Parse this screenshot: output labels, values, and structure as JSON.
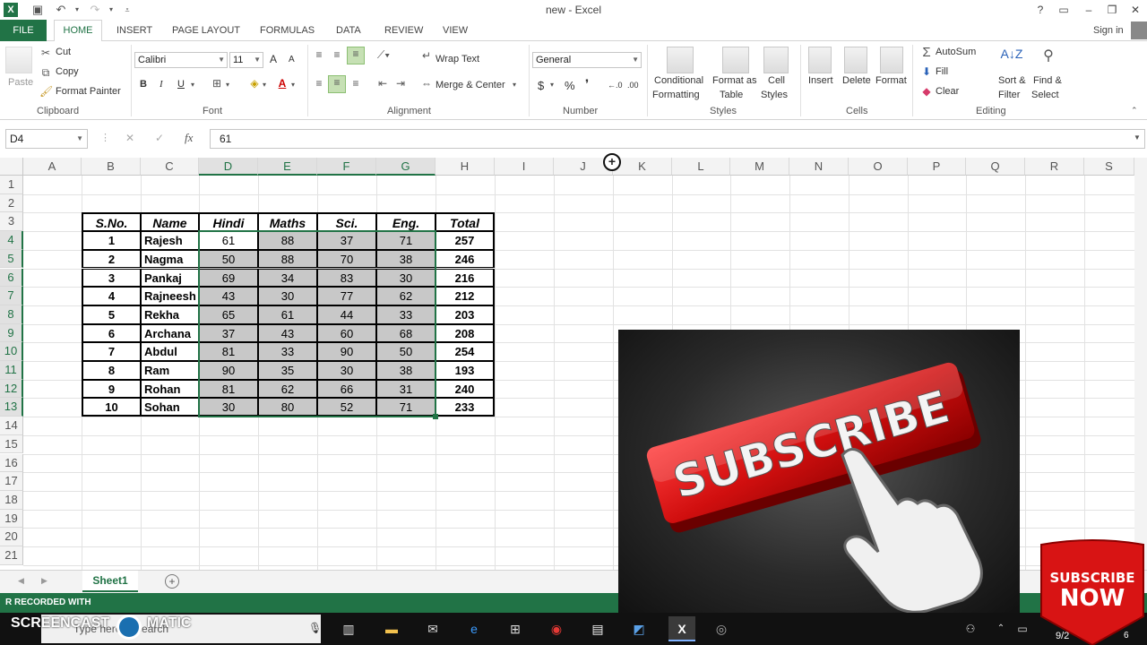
{
  "window": {
    "title": "new - Excel",
    "help": "?",
    "minimize": "–",
    "restore": "❐",
    "close": "✕"
  },
  "qat": {
    "excel_icon": "excel-app-icon",
    "save_icon": "save-icon",
    "undo_icon": "undo-icon",
    "redo_icon": "redo-icon"
  },
  "tabs": {
    "file": "FILE",
    "home": "HOME",
    "insert": "INSERT",
    "page_layout": "PAGE LAYOUT",
    "formulas": "FORMULAS",
    "data": "DATA",
    "review": "REVIEW",
    "view": "VIEW",
    "signin": "Sign in"
  },
  "ribbon": {
    "clipboard": {
      "paste": "Paste",
      "cut": "Cut",
      "copy": "Copy",
      "format_painter": "Format Painter",
      "label": "Clipboard"
    },
    "font": {
      "name": "Calibri",
      "size": "11",
      "bold": "B",
      "italic": "I",
      "underline": "U",
      "grow": "A",
      "shrink": "A",
      "label": "Font"
    },
    "alignment": {
      "wrap_text": "Wrap Text",
      "merge_center": "Merge & Center",
      "label": "Alignment"
    },
    "number": {
      "format": "General",
      "currency": "$",
      "percent": "%",
      "comma": "❜",
      "inc_decimal": "←.0",
      "dec_decimal": ".00",
      "label": "Number"
    },
    "styles": {
      "conditional_1": "Conditional",
      "conditional_2": "Formatting",
      "format_table_1": "Format as",
      "format_table_2": "Table",
      "cell_styles_1": "Cell",
      "cell_styles_2": "Styles",
      "label": "Styles"
    },
    "cells": {
      "insert": "Insert",
      "delete": "Delete",
      "format": "Format",
      "label": "Cells"
    },
    "editing": {
      "autosum": "AutoSum",
      "fill": "Fill",
      "clear": "Clear",
      "sort_1": "Sort &",
      "sort_2": "Filter",
      "find_1": "Find &",
      "find_2": "Select",
      "label": "Editing"
    }
  },
  "formula_bar": {
    "name_box": "D4",
    "cancel": "✕",
    "enter": "✓",
    "fx": "fx",
    "value": "61"
  },
  "columns": [
    "A",
    "B",
    "C",
    "D",
    "E",
    "F",
    "G",
    "H",
    "I",
    "J",
    "K",
    "L",
    "M",
    "N",
    "O",
    "P",
    "Q",
    "R",
    "S"
  ],
  "rows": [
    "1",
    "2",
    "3",
    "4",
    "5",
    "6",
    "7",
    "8",
    "9",
    "10",
    "11",
    "12",
    "13",
    "14",
    "15",
    "16",
    "17",
    "18",
    "19",
    "20",
    "21"
  ],
  "table": {
    "headers": [
      "S.No.",
      "Name",
      "Hindi",
      "Maths",
      "Sci.",
      "Eng.",
      "Total"
    ],
    "rows": [
      [
        "1",
        "Rajesh",
        "61",
        "88",
        "37",
        "71",
        "257"
      ],
      [
        "2",
        "Nagma",
        "50",
        "88",
        "70",
        "38",
        "246"
      ],
      [
        "3",
        "Pankaj",
        "69",
        "34",
        "83",
        "30",
        "216"
      ],
      [
        "4",
        "Rajneesh",
        "43",
        "30",
        "77",
        "62",
        "212"
      ],
      [
        "5",
        "Rekha",
        "65",
        "61",
        "44",
        "33",
        "203"
      ],
      [
        "6",
        "Archana",
        "37",
        "43",
        "60",
        "68",
        "208"
      ],
      [
        "7",
        "Abdul",
        "81",
        "33",
        "90",
        "50",
        "254"
      ],
      [
        "8",
        "Ram",
        "90",
        "35",
        "30",
        "38",
        "193"
      ],
      [
        "9",
        "Rohan",
        "81",
        "62",
        "66",
        "31",
        "240"
      ],
      [
        "10",
        "Sohan",
        "30",
        "80",
        "52",
        "71",
        "233"
      ]
    ]
  },
  "sheets": {
    "active": "Sheet1",
    "add": "+"
  },
  "status": {
    "text": "R RECORDED WITH"
  },
  "watermark": {
    "line1": "SCREENCAST",
    "line2": "MATIC"
  },
  "taskbar": {
    "search_placeholder": "Type here to search",
    "time": "9/2",
    "notif": "6"
  },
  "overlay": {
    "subscribe": "SUBSCRIBE",
    "badge_line1": "SUBSCRIBE",
    "badge_line2": "NOW"
  },
  "colors": {
    "excel_green": "#217346",
    "selection_fill": "#c6c6c6",
    "subscribe_red": "#d11212"
  }
}
